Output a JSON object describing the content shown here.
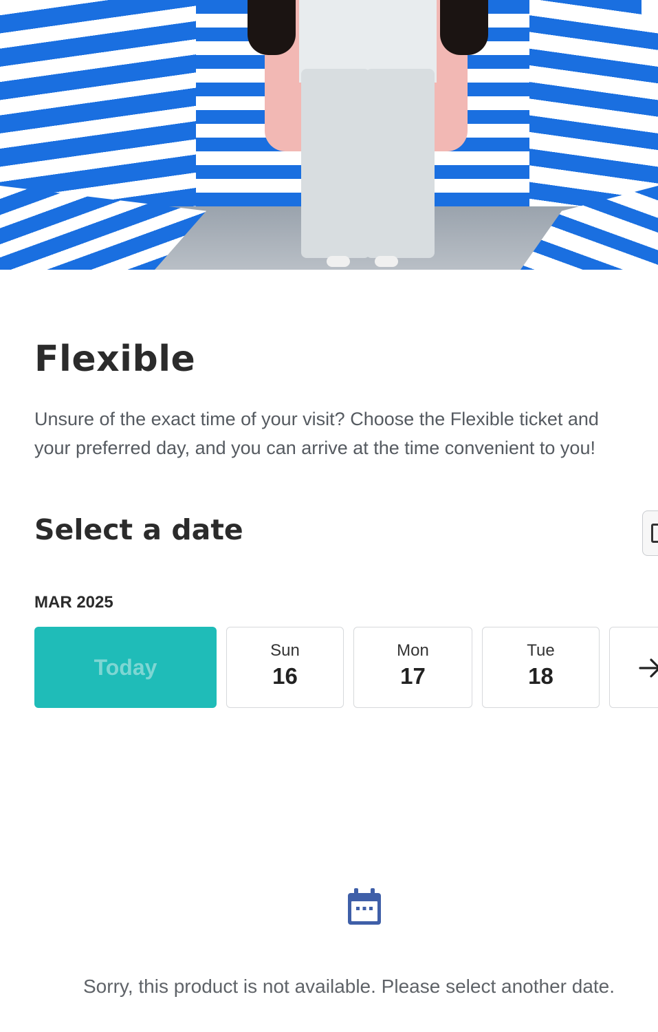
{
  "product": {
    "title": "Flexible",
    "description_line1": "Unsure of the exact time of your visit? Choose the Flexible ticket and",
    "description_line2": "your preferred day, and you can arrive at the time convenient to you!"
  },
  "date_picker": {
    "heading": "Select a date",
    "calendar_icon": "calendar-icon",
    "month_label": "MAR 2025",
    "today_label": "Today",
    "days": [
      {
        "weekday": "Sun",
        "day": "16"
      },
      {
        "weekday": "Mon",
        "day": "17"
      },
      {
        "weekday": "Tue",
        "day": "18"
      }
    ],
    "next_icon": "arrow-right-icon"
  },
  "availability": {
    "icon": "calendar-icon",
    "message": "Sorry, this product is not available. Please select another date."
  },
  "colors": {
    "today_bg": "#1fbcb8",
    "icon_blue": "#3f5fa8"
  }
}
